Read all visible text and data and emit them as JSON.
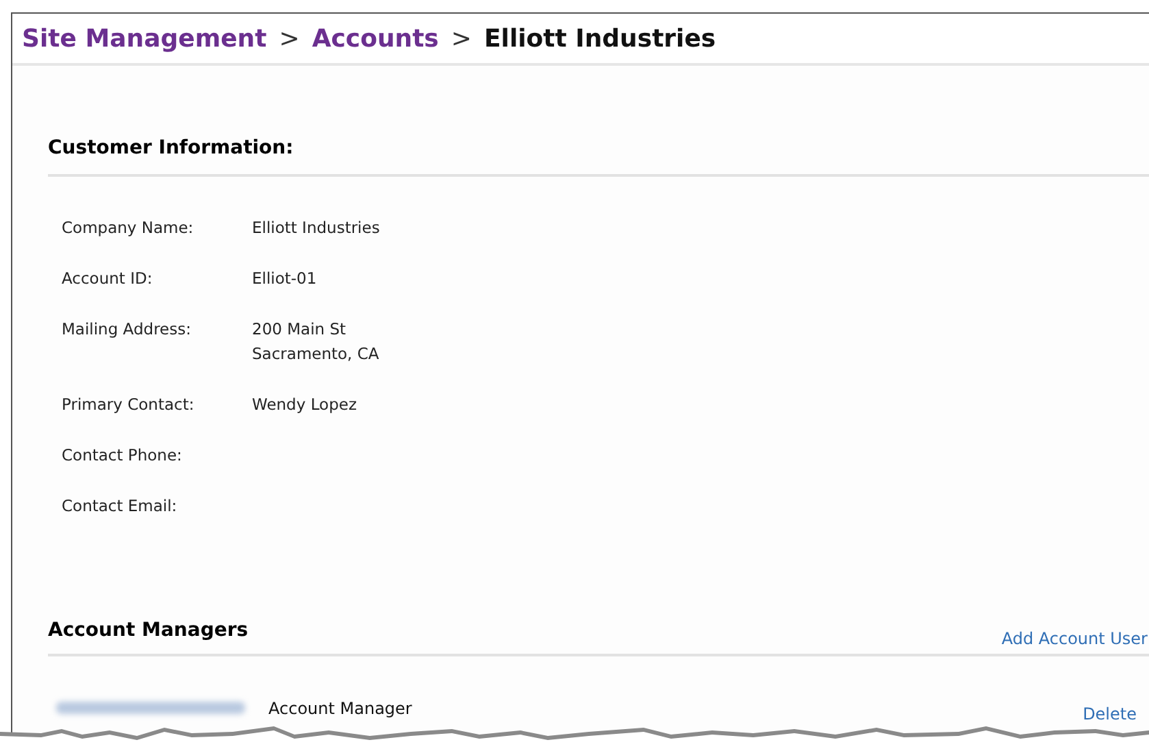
{
  "breadcrumb": [
    {
      "label": "Site Management",
      "kind": "link"
    },
    {
      "label": "Accounts",
      "kind": "link"
    },
    {
      "label": "Elliott Industries",
      "kind": "current"
    }
  ],
  "breadcrumb_separator": ">",
  "customer_information": {
    "title": "Customer Information:",
    "fields": [
      {
        "label": "Company Name:",
        "value": [
          "Elliott Industries"
        ]
      },
      {
        "label": "Account ID:",
        "value": [
          "Elliot-01"
        ]
      },
      {
        "label": "Mailing Address:",
        "value": [
          "200 Main St",
          "Sacramento, CA"
        ]
      },
      {
        "label": "Primary Contact:",
        "value": [
          "Wendy Lopez"
        ]
      },
      {
        "label": "Contact Phone:"
      },
      {
        "label": "Contact Email:"
      }
    ]
  },
  "account_managers": {
    "title": "Account Managers",
    "add_link": "Add Account User",
    "rows": [
      {
        "role": "Account Manager",
        "action": "Delete"
      }
    ]
  }
}
